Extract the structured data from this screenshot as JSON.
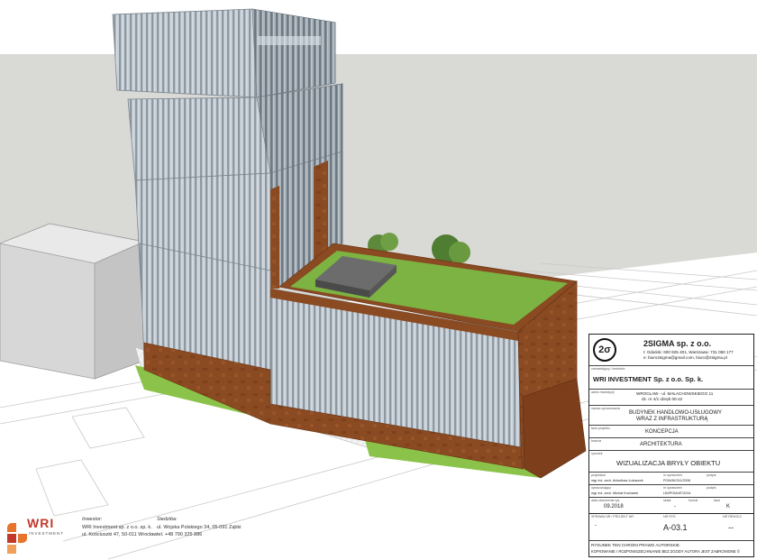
{
  "company": {
    "name": "2SIGMA sp. z o.o.",
    "logo_text": "2σ",
    "contact_line1": "t: Gdańsk: 600 925 401, Warszawa: 731 050 177",
    "contact_line2": "e: biuro2sigma@gmail.com, biuro@2sigma.pl"
  },
  "titleblock": {
    "investor_label": "zamawiający / inwestor:",
    "investor": "WRI INVESTMENT  Sp. z o.o. Sp. k.",
    "address_label": "adres inwestycji",
    "address_line1": "WROCŁAW - ul. MAŁACHOWSKIEGO 11",
    "address_line2": "dz. nr 4/1 obręb 00-22",
    "object_label": "nazwa opracowania",
    "object_line1": "BUDYNEK HANDLOWO-USŁUGOWY",
    "object_line2": "WRAZ Z INFRASTRUKTURĄ",
    "stage_label": "faza projektu",
    "stage": "KONCEPCJA",
    "branch_label": "branża",
    "branch": "ARCHITEKTURA",
    "sheet_label": "rysunek",
    "sheet_title": "WIZUALIZACJA BRYŁY OBIEKTU",
    "designer_label": "projektant",
    "designer": "mgr inż. arch. Arkadiusz Łukaszek",
    "permit_label": "nr uprawnień",
    "permit": "POM/KI/311/2008",
    "sign_label": "podpis",
    "drafter_label": "opracowujący",
    "drafter": "mgr inż. arch. Michał Kucharek",
    "drafter_permit_label": "nr uprawnień",
    "drafter_permit": "LBI/POM/AT/2014",
    "drafter_sign_label": "podpis",
    "date_label": "data utworzenia rys.",
    "date": "09.2018",
    "scale_label": "skala",
    "scale": "-",
    "format_label": "format",
    "format": "",
    "stage_code_label": "faza",
    "stage_code": "K",
    "project_no_label": "SPRAWA NR / PROJEKT NR",
    "project_no": "-",
    "drawing_no_label": "NR RYS.",
    "drawing_no": "A-03.1",
    "revision_label": "NR REWIZJI",
    "revision": "--",
    "copyright_line1": "RYSUNEK TEN CHRONI PRAWO AUTORSKIE.",
    "copyright_line2": "KOPIOWANIE I ROZPOWSZECHNIANIE BEZ ZGODY AUTORA JEST ZABRONIONE ©"
  },
  "footer": {
    "wri_logo": "WRI",
    "wri_sub": "INVESTMENT",
    "investor_title": "Inwestor:",
    "investor_line1": "WRI Investment sp. z o.o. sp. k.",
    "investor_line2": "ul. Kościuszki 47, 50-011 Wrocław",
    "seat_title": "Siedziba:",
    "seat_line1": "ul. Wojska Polskiego 34, 05-091 Ząbki",
    "seat_line2": "tel. +48 790 325 886"
  },
  "colors": {
    "corten": "#8a4a22",
    "corten_dark": "#6e3716",
    "grass": "#7cb342",
    "glass": "#b7c3cd",
    "fin": "#9aa4ad",
    "wri_orange": "#e8742c",
    "wri_red": "#c0392b"
  }
}
